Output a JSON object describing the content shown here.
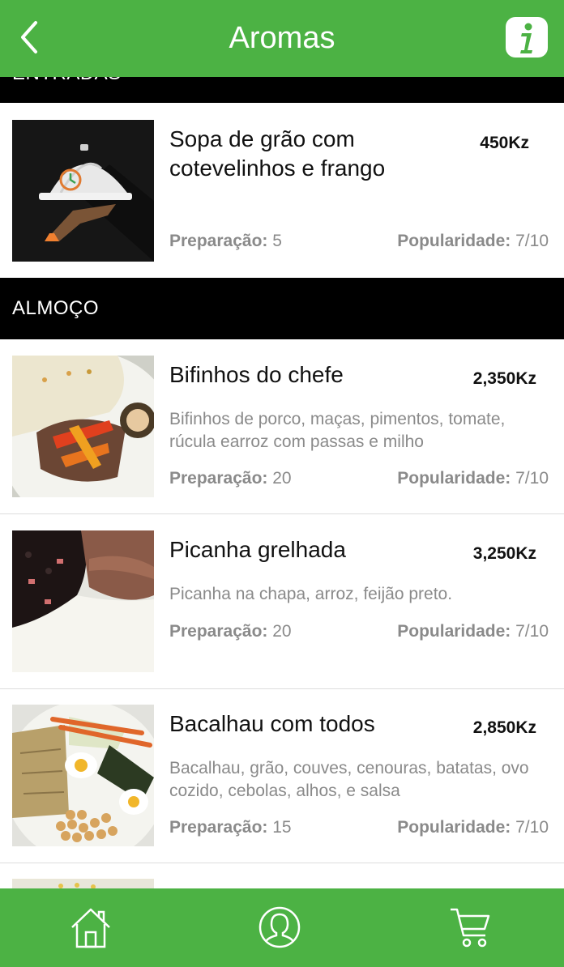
{
  "header": {
    "title": "Aromas",
    "back_icon": "chevron-left-icon",
    "info_icon": "info-icon"
  },
  "sections": [
    {
      "title": "ENTRADAS",
      "items": [
        {
          "name": "Sopa de grão com cotevelinhos e frango",
          "price": "450Kz",
          "description": "",
          "prep_label": "Preparação:",
          "prep_value": "5",
          "pop_label": "Popularidade:",
          "pop_value": "7/10",
          "image": "placeholder-cloche"
        }
      ]
    },
    {
      "title": "ALMOÇO",
      "items": [
        {
          "name": "Bifinhos do chefe",
          "price": "2,350Kz",
          "description": "Bifinhos de porco, maças, pimentos, tomate, rúcula earroz com passas e milho",
          "prep_label": "Preparação:",
          "prep_value": "20",
          "pop_label": "Popularidade:",
          "pop_value": "7/10",
          "image": "dish-photo"
        },
        {
          "name": "Picanha grelhada",
          "price": "3,250Kz",
          "description": "Picanha na chapa, arroz, feijão preto.",
          "prep_label": "Preparação:",
          "prep_value": "20",
          "pop_label": "Popularidade:",
          "pop_value": "7/10",
          "image": "dish-photo"
        },
        {
          "name": "Bacalhau com todos",
          "price": "2,850Kz",
          "description": "Bacalhau, grão, couves, cenouras, batatas, ovo cozido, cebolas, alhos, e salsa",
          "prep_label": "Preparação:",
          "prep_value": "15",
          "pop_label": "Popularidade:",
          "pop_value": "7/10",
          "image": "dish-photo"
        }
      ]
    }
  ],
  "footer": {
    "icons": [
      "home-icon",
      "profile-icon",
      "cart-icon"
    ]
  },
  "colors": {
    "brand_green": "#4cb244",
    "section_bg": "#000000",
    "muted_text": "#8a8a8a"
  }
}
